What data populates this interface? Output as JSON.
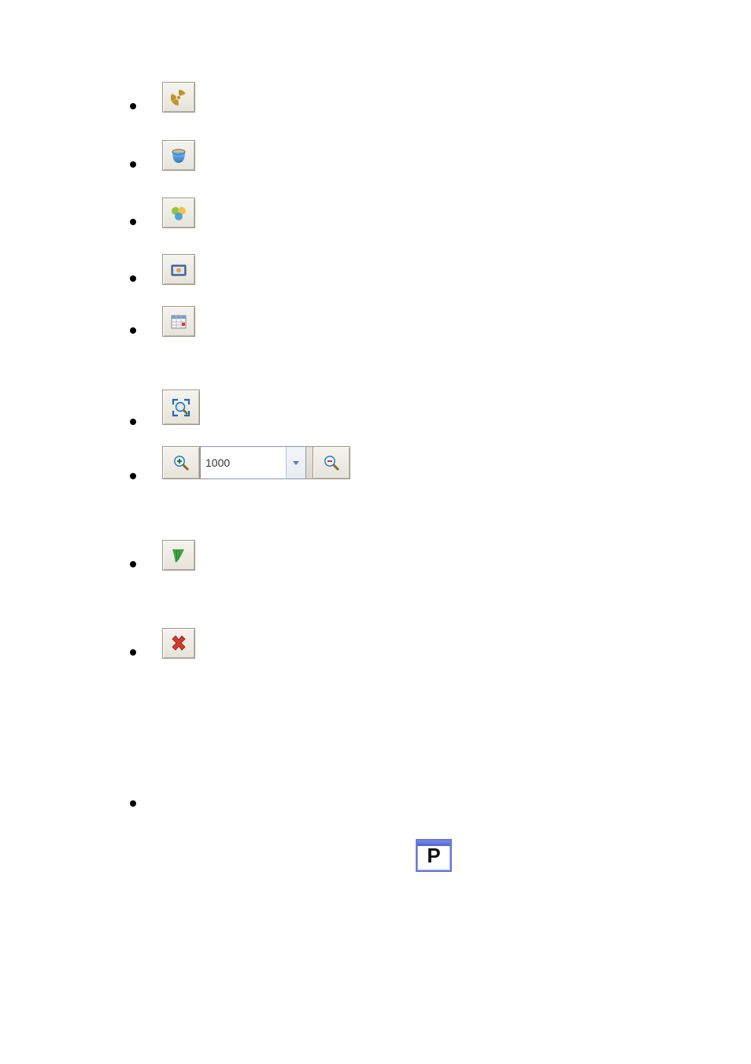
{
  "zoom": {
    "value": "1000"
  },
  "pbox": {
    "letter": "P"
  },
  "icons": {
    "radioactive": "radioactive-icon",
    "bucket": "bucket-icon",
    "shapes": "shapes-icon",
    "picture": "picture-icon",
    "datagrid": "datagrid-icon",
    "zoom_fit": "zoom-fit-icon",
    "zoom_in": "zoom-in-icon",
    "zoom_out": "zoom-out-icon",
    "chevron_down": "chevron-down-icon",
    "sweep": "sweep-icon",
    "delete": "delete-icon"
  }
}
